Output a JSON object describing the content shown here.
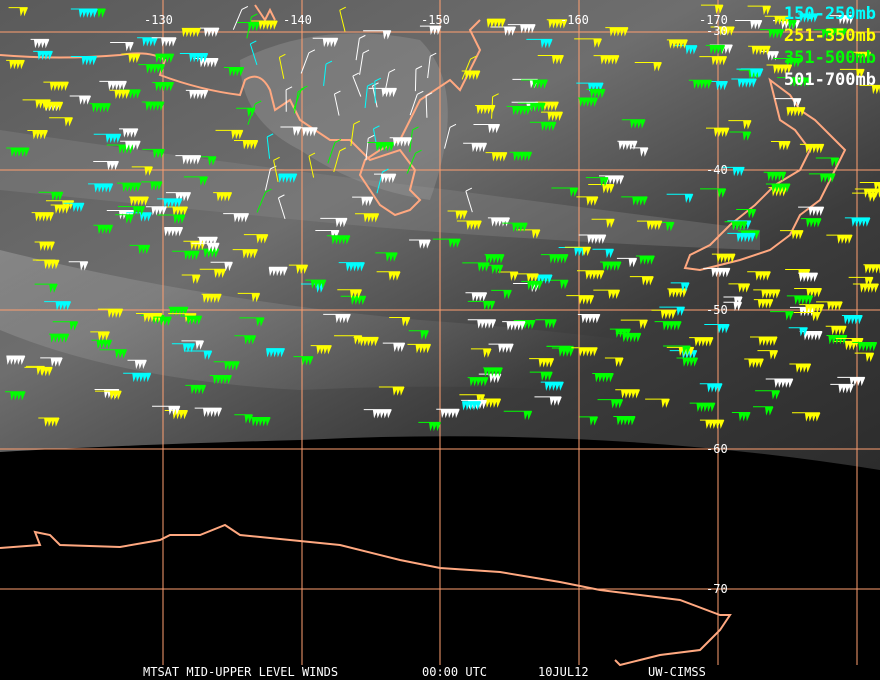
{
  "longitude_labels": [
    "-130",
    "-140",
    "-150",
    "-160",
    "-170"
  ],
  "latitude_labels": [
    "-30",
    "-40",
    "-50",
    "-60",
    "-70"
  ],
  "legend": [
    {
      "label": "150-250mb",
      "color": "#00ffff"
    },
    {
      "label": "251-350mb",
      "color": "#ffff00"
    },
    {
      "label": "351-500mb",
      "color": "#00ff00"
    },
    {
      "label": "501-700mb",
      "color": "#ffffff"
    }
  ],
  "caption": {
    "title": "MTSAT MID-UPPER LEVEL WINDS",
    "time": "00:00 UTC",
    "date": "10JUL12",
    "source": "UW-CIMSS"
  },
  "colors": {
    "grid": "#ff9f70",
    "coast": "#ffa880"
  }
}
